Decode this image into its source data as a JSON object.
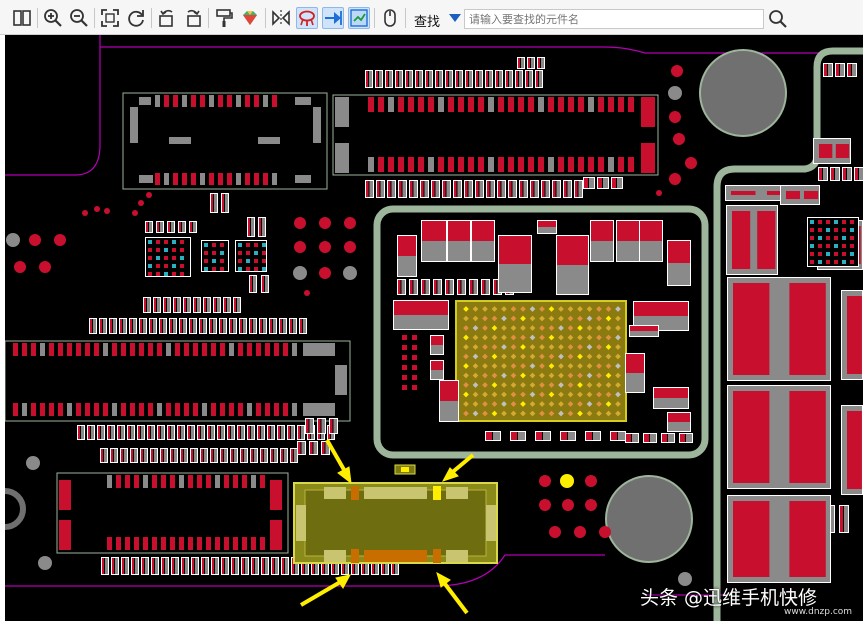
{
  "toolbar": {
    "find_label": "查找",
    "search_placeholder": "请输入要查找的元件名",
    "buttons": [
      "split-view-icon",
      "zoom-in-icon",
      "zoom-out-icon",
      "fit-view-icon",
      "refresh-icon",
      "rotate-left-icon",
      "rotate-right-icon",
      "paint-icon",
      "gem-icon",
      "mirror-icon",
      "net-highlight-icon",
      "arrow-right-icon",
      "select-tool-icon",
      "mouse-icon"
    ]
  },
  "board": {
    "highlighted_component": "selected-connector",
    "colors": {
      "background": "#000000",
      "pad_red": "#c8102e",
      "pad_gray": "#8a8a8a",
      "outline": "#9db59b",
      "highlight": "#b8b438",
      "arrow": "#ffee00",
      "board_edge": "#b400b4"
    }
  },
  "watermark": {
    "text": "头条 @迅维手机快修",
    "url": "www.dnzp.com"
  }
}
